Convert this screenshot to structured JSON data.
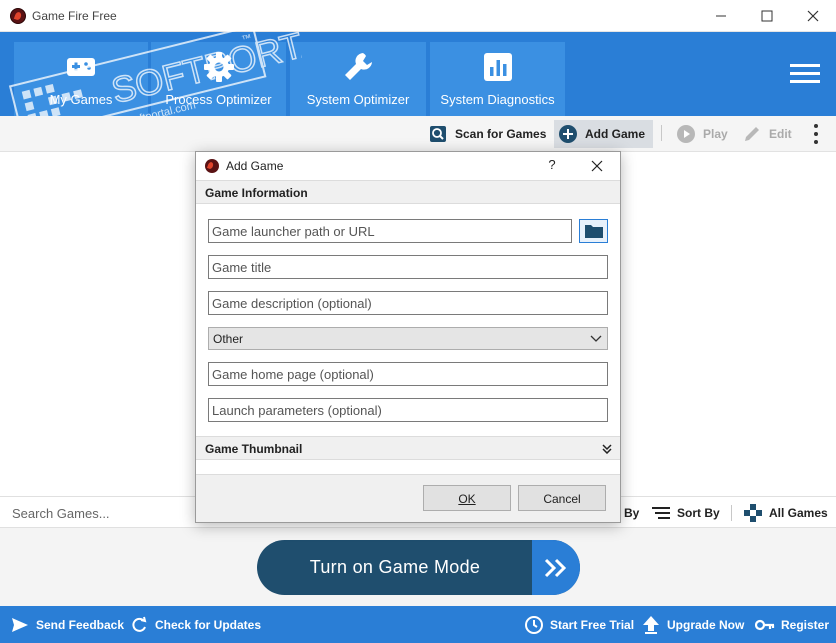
{
  "window": {
    "title": "Game Fire Free",
    "minimize": "—",
    "maximize": "☐",
    "close": "✕"
  },
  "colors": {
    "header_blue": "#2a7ed6",
    "tab_blue": "#3b90e2",
    "game_mode_dark": "#1f4e6e"
  },
  "nav": {
    "tabs": [
      {
        "label": "My Games",
        "icon": "gamepad-icon"
      },
      {
        "label": "Process Optimizer",
        "icon": "gear-icon"
      },
      {
        "label": "System Optimizer",
        "icon": "wrench-icon"
      },
      {
        "label": "System Diagnostics",
        "icon": "bar-chart-icon"
      }
    ],
    "menu_icon": "hamburger-menu-icon"
  },
  "watermark": {
    "text": "SOFTPORTAL",
    "tm": "™",
    "url": "www.softportal.com"
  },
  "toolbar": {
    "scan_label": "Scan for Games",
    "add_label": "Add Game",
    "play_label": "Play",
    "edit_label": "Edit"
  },
  "search": {
    "placeholder": "Search Games..."
  },
  "listbar": {
    "group_by_tail": "By",
    "sort_by": "Sort By",
    "all_games": "All Games"
  },
  "game_mode": {
    "label": "Turn on Game Mode"
  },
  "footer": {
    "send_feedback": "Send Feedback",
    "check_updates": "Check for Updates",
    "free_trial": "Start Free Trial",
    "upgrade": "Upgrade Now",
    "register": "Register"
  },
  "dialog": {
    "title": "Add Game",
    "help": "?",
    "close": "✕",
    "section_info": "Game Information",
    "launcher_placeholder": "Game launcher path or URL",
    "title_placeholder": "Game title",
    "description_placeholder": "Game description (optional)",
    "category_value": "Other",
    "homepage_placeholder": "Game home page (optional)",
    "params_placeholder": "Launch parameters (optional)",
    "section_thumbnail": "Game Thumbnail",
    "ok": "OK",
    "cancel": "Cancel"
  }
}
